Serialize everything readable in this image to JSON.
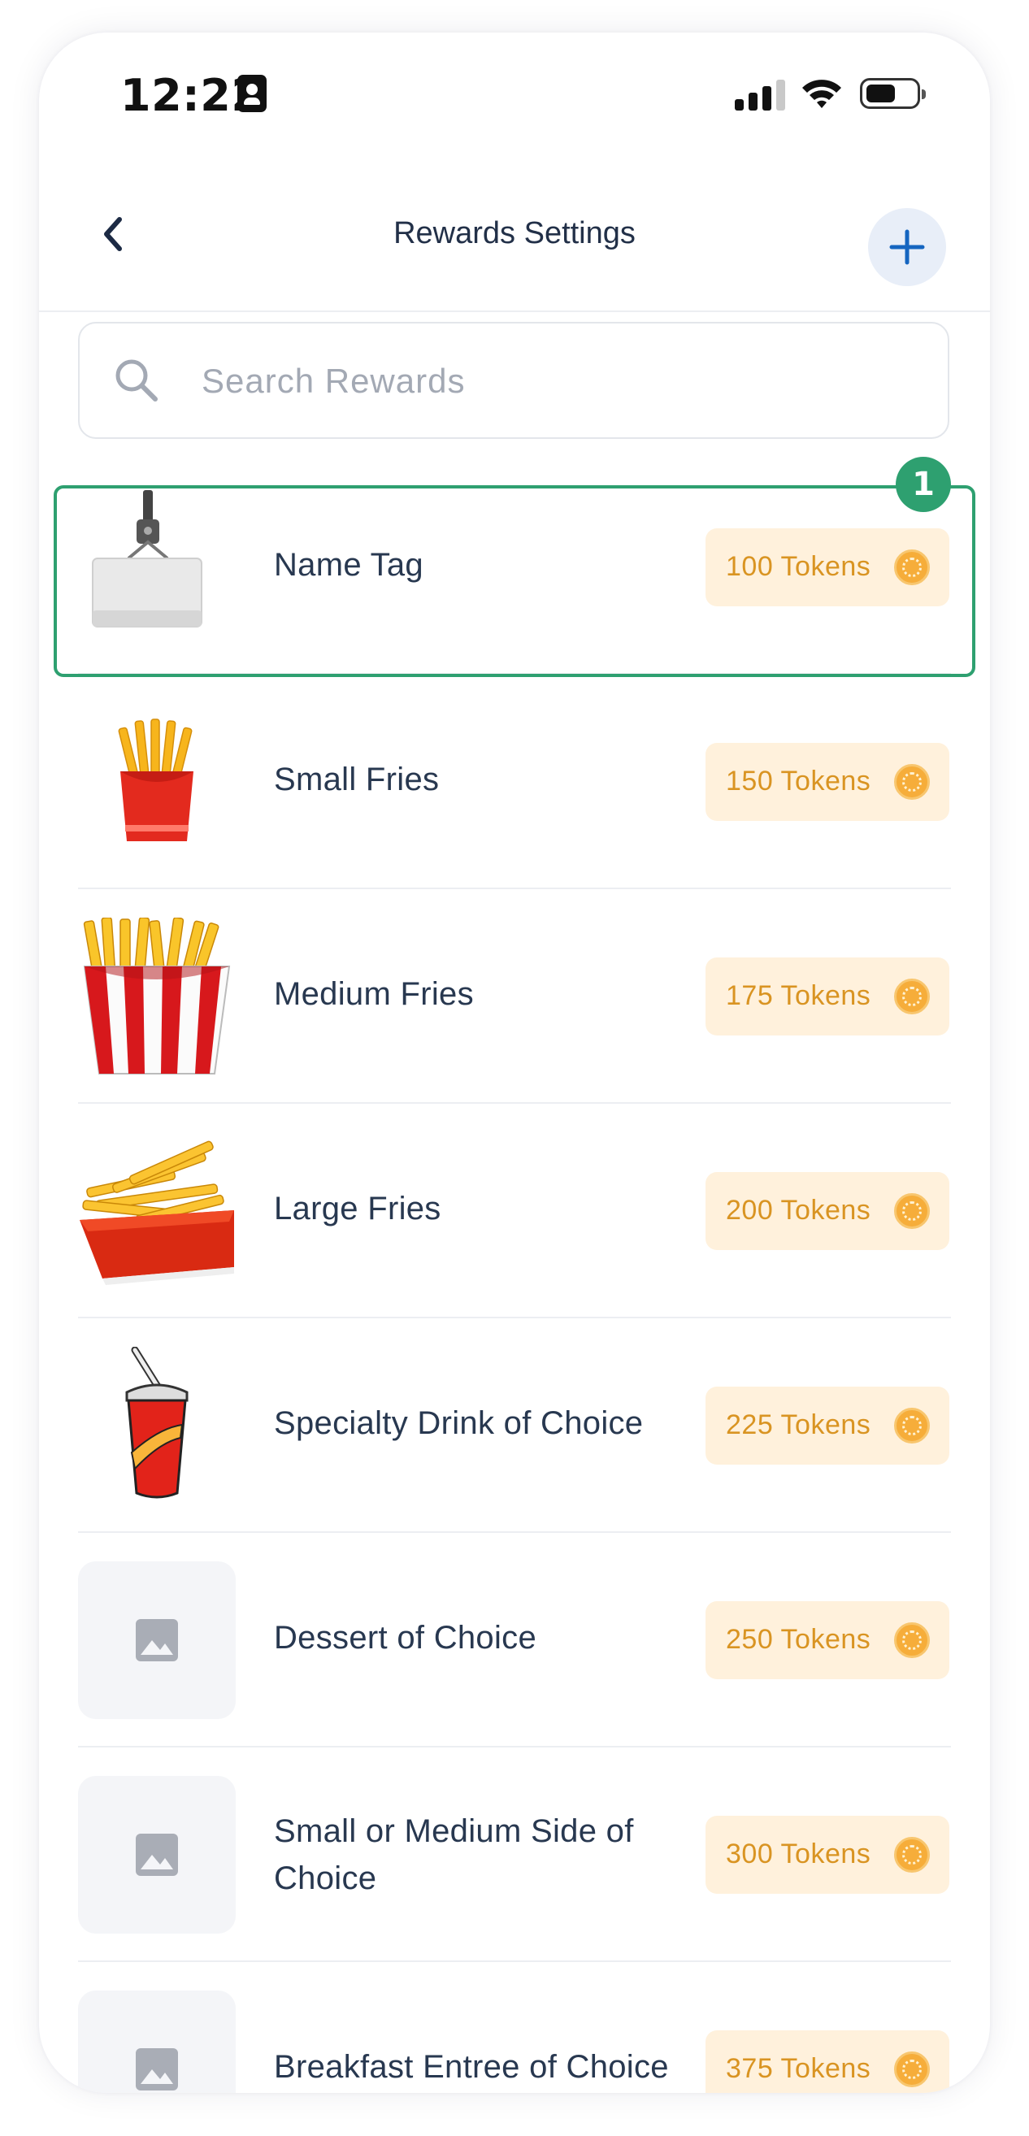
{
  "status_bar": {
    "time": "12:22"
  },
  "header": {
    "title": "Rewards Settings"
  },
  "search": {
    "placeholder": "Search Rewards"
  },
  "annotation": {
    "badge": "1"
  },
  "rewards": [
    {
      "name": "Name Tag",
      "tokens": "100 Tokens",
      "image": "name-tag"
    },
    {
      "name": "Small Fries",
      "tokens": "150 Tokens",
      "image": "small-fries"
    },
    {
      "name": "Medium Fries",
      "tokens": "175 Tokens",
      "image": "medium-fries"
    },
    {
      "name": "Large Fries",
      "tokens": "200 Tokens",
      "image": "large-fries"
    },
    {
      "name": "Specialty Drink of Choice",
      "tokens": "225 Tokens",
      "image": "drink"
    },
    {
      "name": "Dessert of Choice",
      "tokens": "250 Tokens",
      "image": "placeholder-image-icon"
    },
    {
      "name": "Small or Medium Side of Choice",
      "tokens": "300 Tokens",
      "image": "placeholder-image-icon"
    },
    {
      "name": "Breakfast Entree of Choice",
      "tokens": "375 Tokens",
      "image": "placeholder-image-icon"
    }
  ],
  "colors": {
    "accent_blue": "#1565c0",
    "token_bg": "#fff1dc",
    "token_text": "#d99422",
    "highlight": "#2ea070"
  }
}
